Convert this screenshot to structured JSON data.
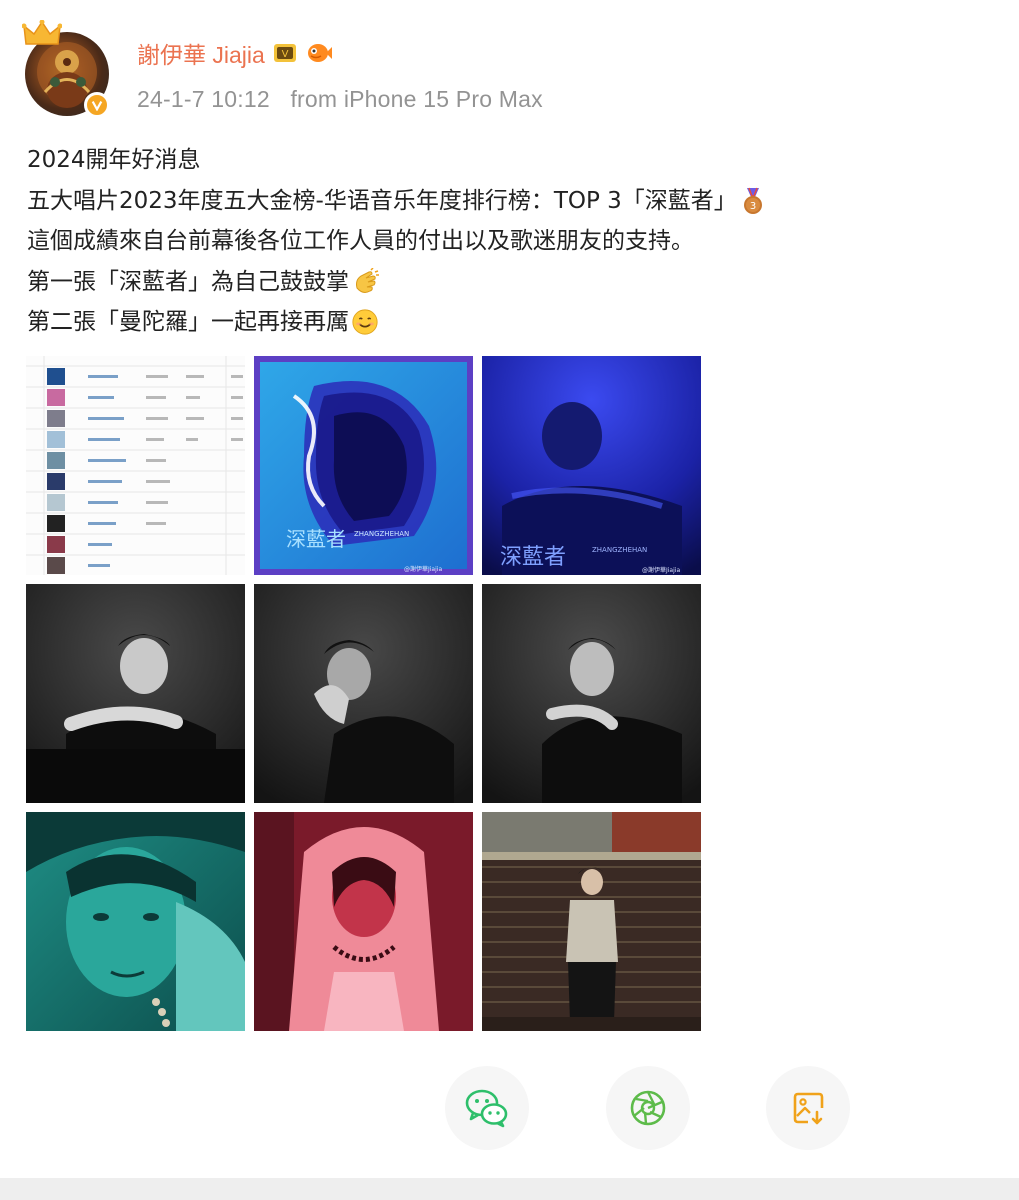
{
  "user": {
    "name": "謝伊華 Jiajia",
    "timestamp": "24-1-7 10:12",
    "source": "from iPhone 15 Pro Max"
  },
  "post": {
    "lines": [
      "2024開年好消息",
      "五大唱片2023年度五大金榜-华语音乐年度排行榜：TOP 3「深藍者」",
      "這個成績來自台前幕後各位工作人員的付出以及歌迷朋友的支持。",
      "第一張「深藍者」為自己鼓鼓掌",
      "第二張「曼陀羅」一起再接再厲"
    ]
  },
  "images": [
    {
      "name": "chart-ranking-screenshot"
    },
    {
      "name": "album-cover-blue",
      "cover_title": "深藍者",
      "artist_en": "ZHANGZHEHAN",
      "watermark": "@謝伊華Jiajia"
    },
    {
      "name": "album-photo-blue",
      "cover_title": "深藍者",
      "artist_en": "ZHANGZHEHAN",
      "watermark": "@謝伊華Jiajia"
    },
    {
      "name": "bw-portrait-1"
    },
    {
      "name": "bw-portrait-2"
    },
    {
      "name": "bw-portrait-3"
    },
    {
      "name": "teal-portrait"
    },
    {
      "name": "red-hoodie-portrait"
    },
    {
      "name": "street-shutter-portrait"
    }
  ],
  "actions": [
    {
      "icon": "wechat-icon"
    },
    {
      "icon": "moments-icon"
    },
    {
      "icon": "save-image-icon"
    }
  ],
  "colors": {
    "username": "#eb7350",
    "meta": "#939393",
    "verified": "#f5a623",
    "wechat": "#2ebf6b",
    "moments": "#5dbb4a",
    "save": "#f0a21a"
  }
}
